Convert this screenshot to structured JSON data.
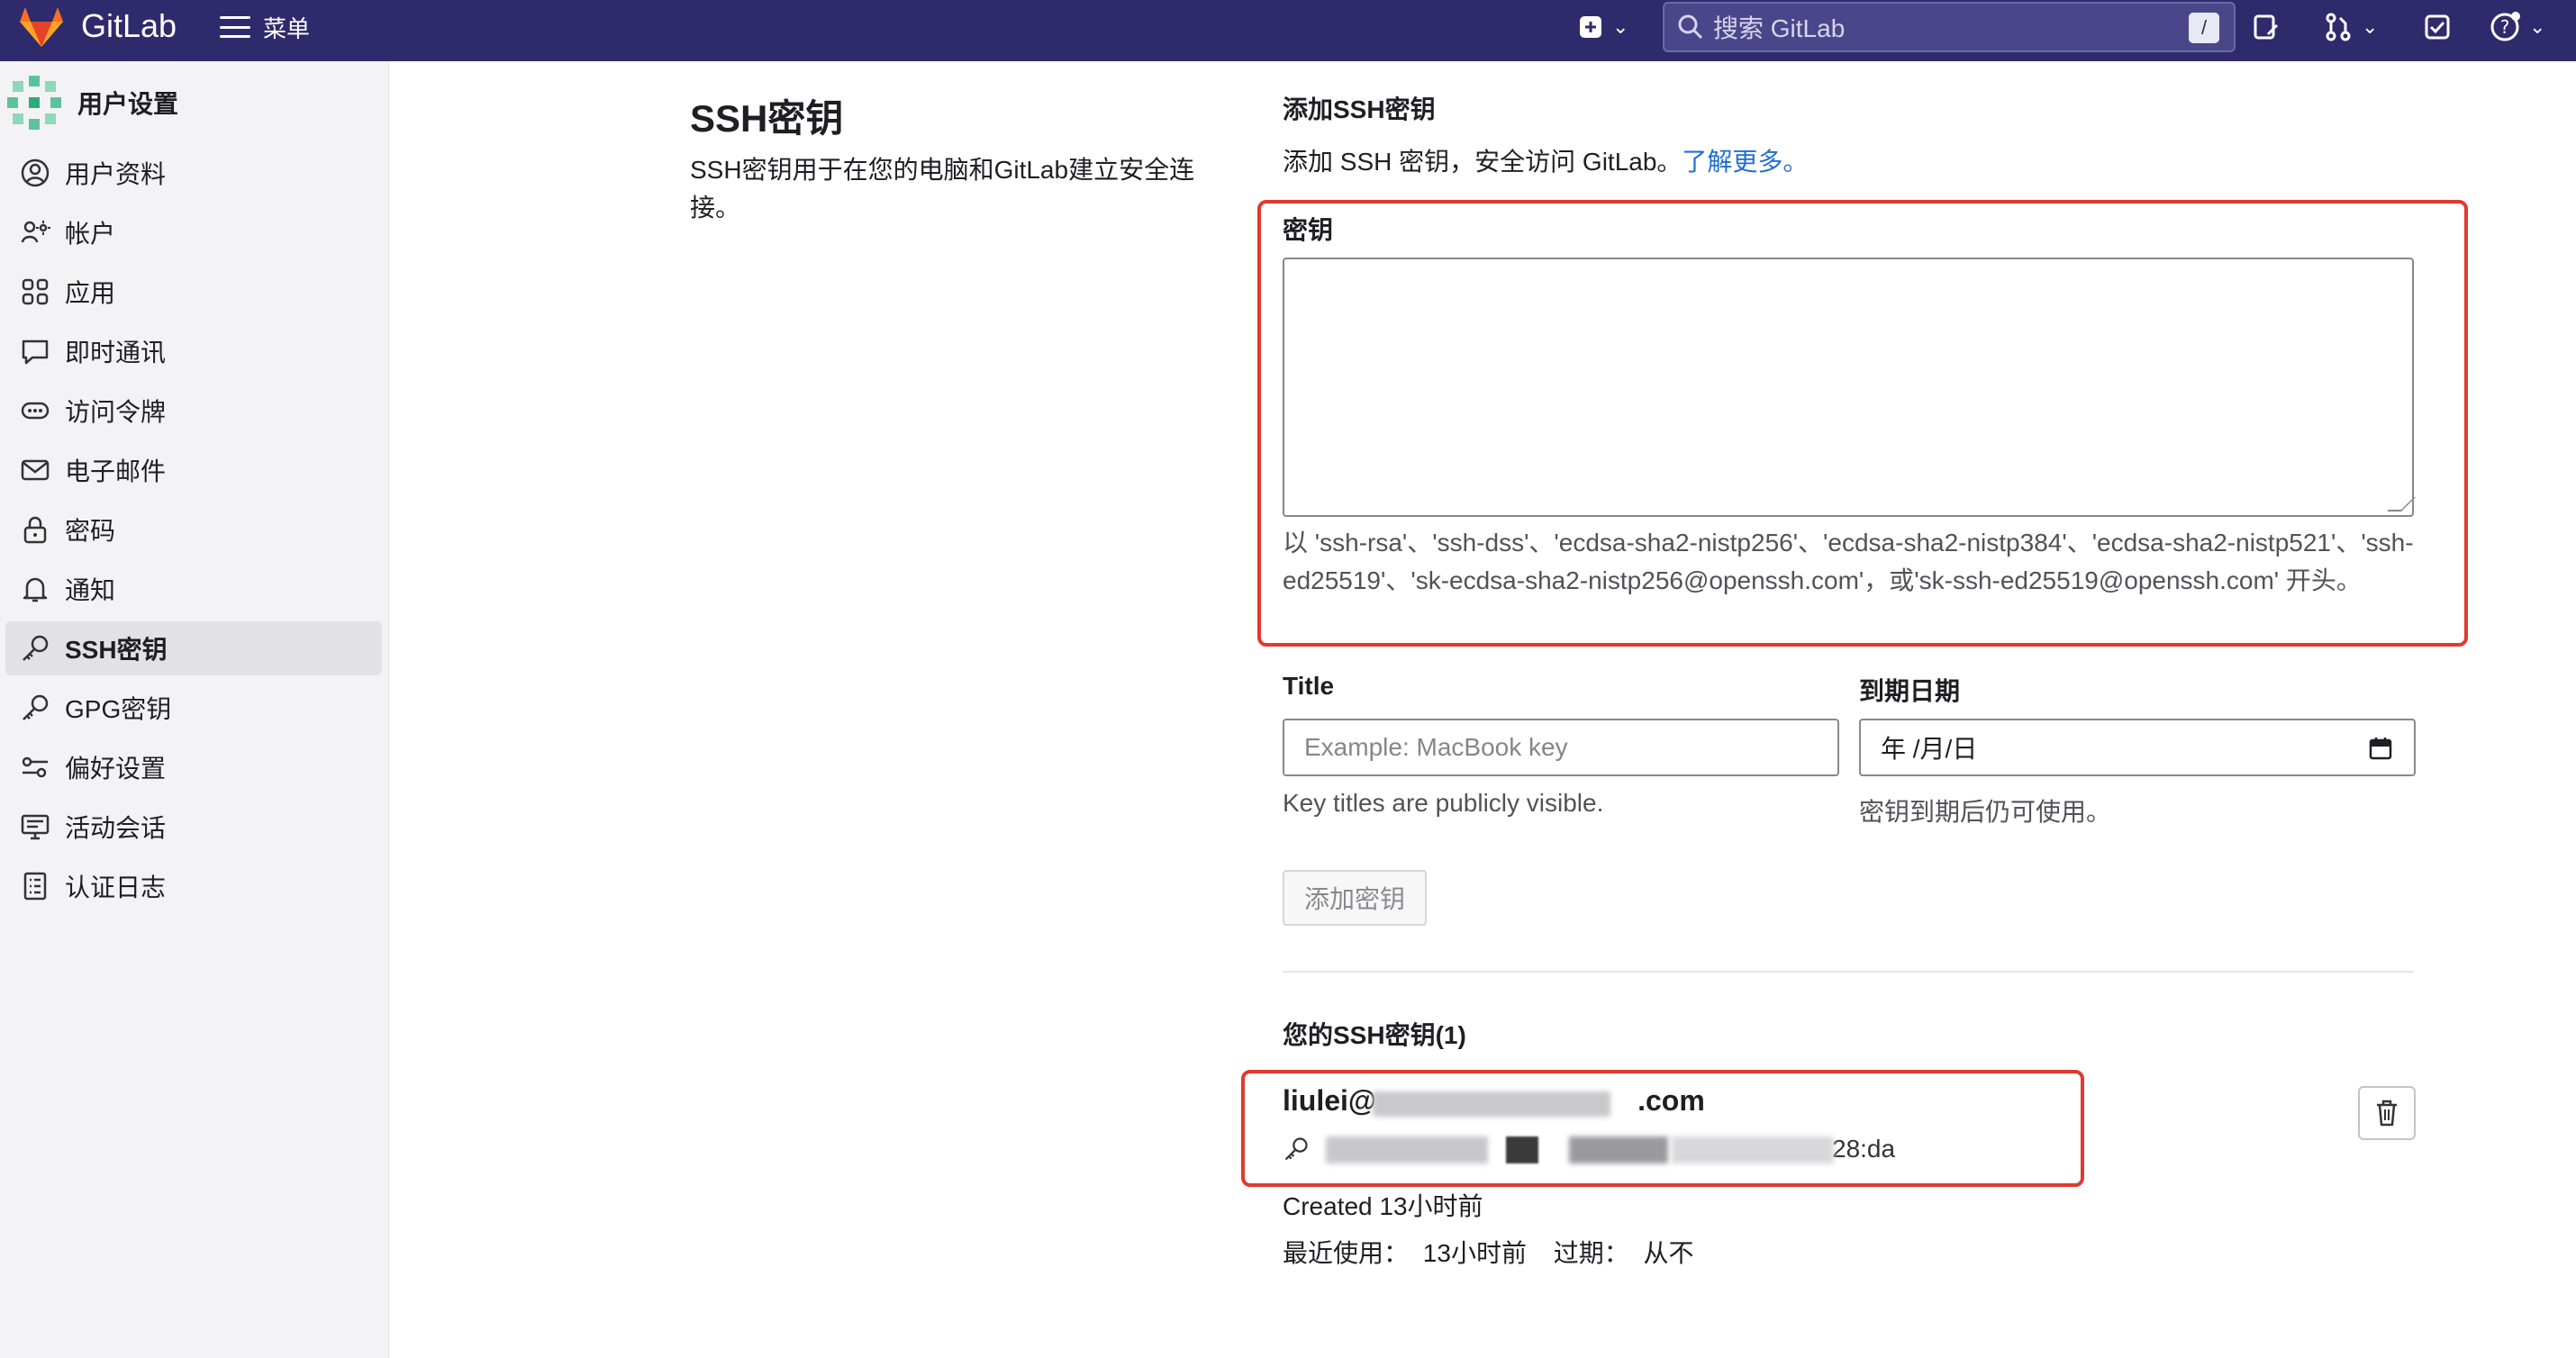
{
  "topbar": {
    "brand": "GitLab",
    "menu_label": "菜单",
    "search_placeholder": "搜索 GitLab",
    "search_shortcut": "/"
  },
  "sidebar": {
    "title": "用户设置",
    "items": [
      {
        "label": "用户资料",
        "icon": "profile-icon"
      },
      {
        "label": "帐户",
        "icon": "account-icon"
      },
      {
        "label": "应用",
        "icon": "applications-icon"
      },
      {
        "label": "即时通讯",
        "icon": "chat-icon"
      },
      {
        "label": "访问令牌",
        "icon": "token-icon"
      },
      {
        "label": "电子邮件",
        "icon": "mail-icon"
      },
      {
        "label": "密码",
        "icon": "lock-icon"
      },
      {
        "label": "通知",
        "icon": "bell-icon"
      },
      {
        "label": "SSH密钥",
        "icon": "key-icon",
        "active": true
      },
      {
        "label": "GPG密钥",
        "icon": "key-icon"
      },
      {
        "label": "偏好设置",
        "icon": "preferences-icon"
      },
      {
        "label": "活动会话",
        "icon": "monitor-icon"
      },
      {
        "label": "认证日志",
        "icon": "log-icon"
      }
    ]
  },
  "main": {
    "title": "SSH密钥",
    "description": "SSH密钥用于在您的电脑和GitLab建立安全连接。"
  },
  "form": {
    "heading": "添加SSH密钥",
    "desc_text": "添加 SSH 密钥，安全访问 GitLab。",
    "learn_more": "了解更多。",
    "key_label": "密钥",
    "key_value": "",
    "key_hint": "以 'ssh-rsa'、'ssh-dss'、'ecdsa-sha2-nistp256'、'ecdsa-sha2-nistp384'、'ecdsa-sha2-nistp521'、'ssh-ed25519'、'sk-ecdsa-sha2-nistp256@openssh.com'，或'sk-ssh-ed25519@openssh.com' 开头。",
    "title_label": "Title",
    "title_placeholder": "Example: MacBook key",
    "title_hint": "Key titles are publicly visible.",
    "expiry_label": "到期日期",
    "expiry_placeholder": "年 /月/日",
    "expiry_hint": "密钥到期后仍可使用。",
    "submit_label": "添加密钥"
  },
  "keys": {
    "heading": "您的SSH密钥(1)",
    "items": [
      {
        "title_start": "liulei@",
        "title_end": ".com",
        "fingerprint_end": "28:da",
        "created": "Created 13小时前",
        "last_used_label": "最近使用：",
        "last_used": "13小时前",
        "expires_label": "过期：",
        "expires": "从不"
      }
    ]
  },
  "colors": {
    "topbar": "#2f2a6b",
    "highlight": "#e03a2e",
    "link": "#1f6fd1"
  }
}
